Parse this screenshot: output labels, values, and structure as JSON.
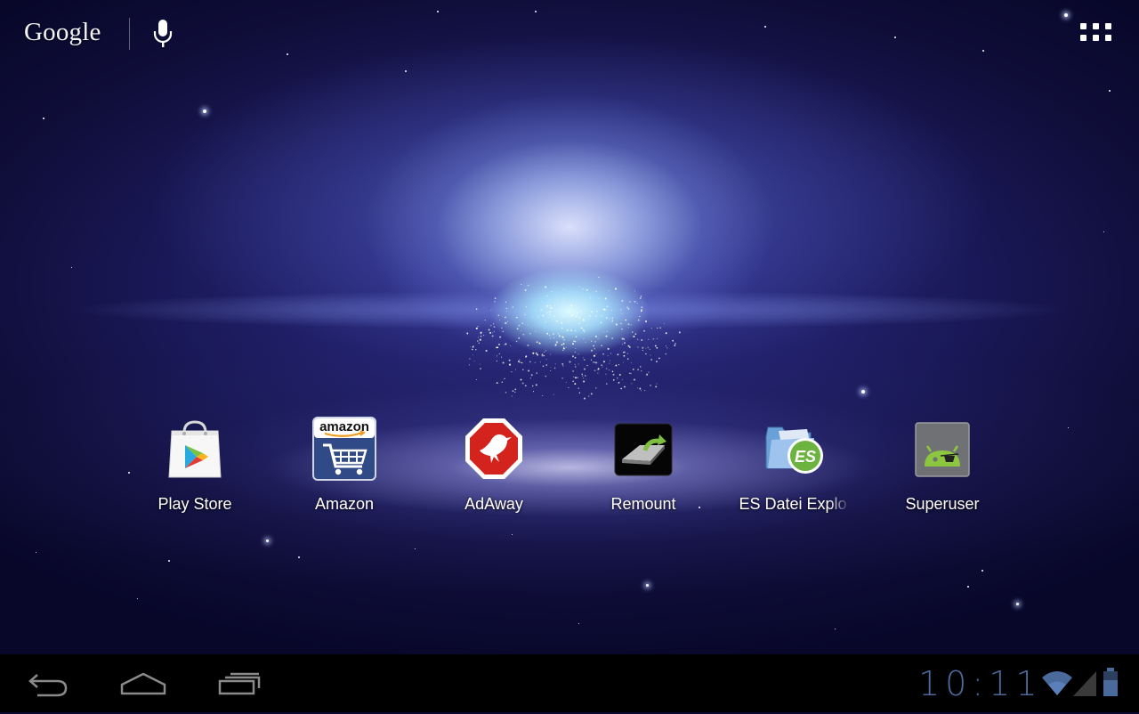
{
  "search_bar": {
    "logo_text": "Google",
    "voice_icon": "mic-icon"
  },
  "app_drawer_icon": "apps-grid-icon",
  "shortcuts": [
    {
      "label": "Play Store",
      "icon": "play-store-icon"
    },
    {
      "label": "Amazon",
      "icon": "amazon-icon",
      "icon_text": "amazon"
    },
    {
      "label": "AdAway",
      "icon": "adaway-icon"
    },
    {
      "label": "Remount",
      "icon": "remount-icon"
    },
    {
      "label": "ES Datei Explo",
      "icon": "es-file-explorer-icon",
      "icon_text": "ES"
    },
    {
      "label": "Superuser",
      "icon": "superuser-icon"
    }
  ],
  "navigation": {
    "back_icon": "back-icon",
    "home_icon": "home-icon",
    "recents_icon": "recent-apps-icon"
  },
  "status": {
    "time": "10:11",
    "icons": [
      "wifi-icon",
      "cell-signal-icon",
      "battery-icon"
    ]
  },
  "colors": {
    "clock": "#4a6a9c",
    "wallpaper_base": "#0b0a2e"
  }
}
